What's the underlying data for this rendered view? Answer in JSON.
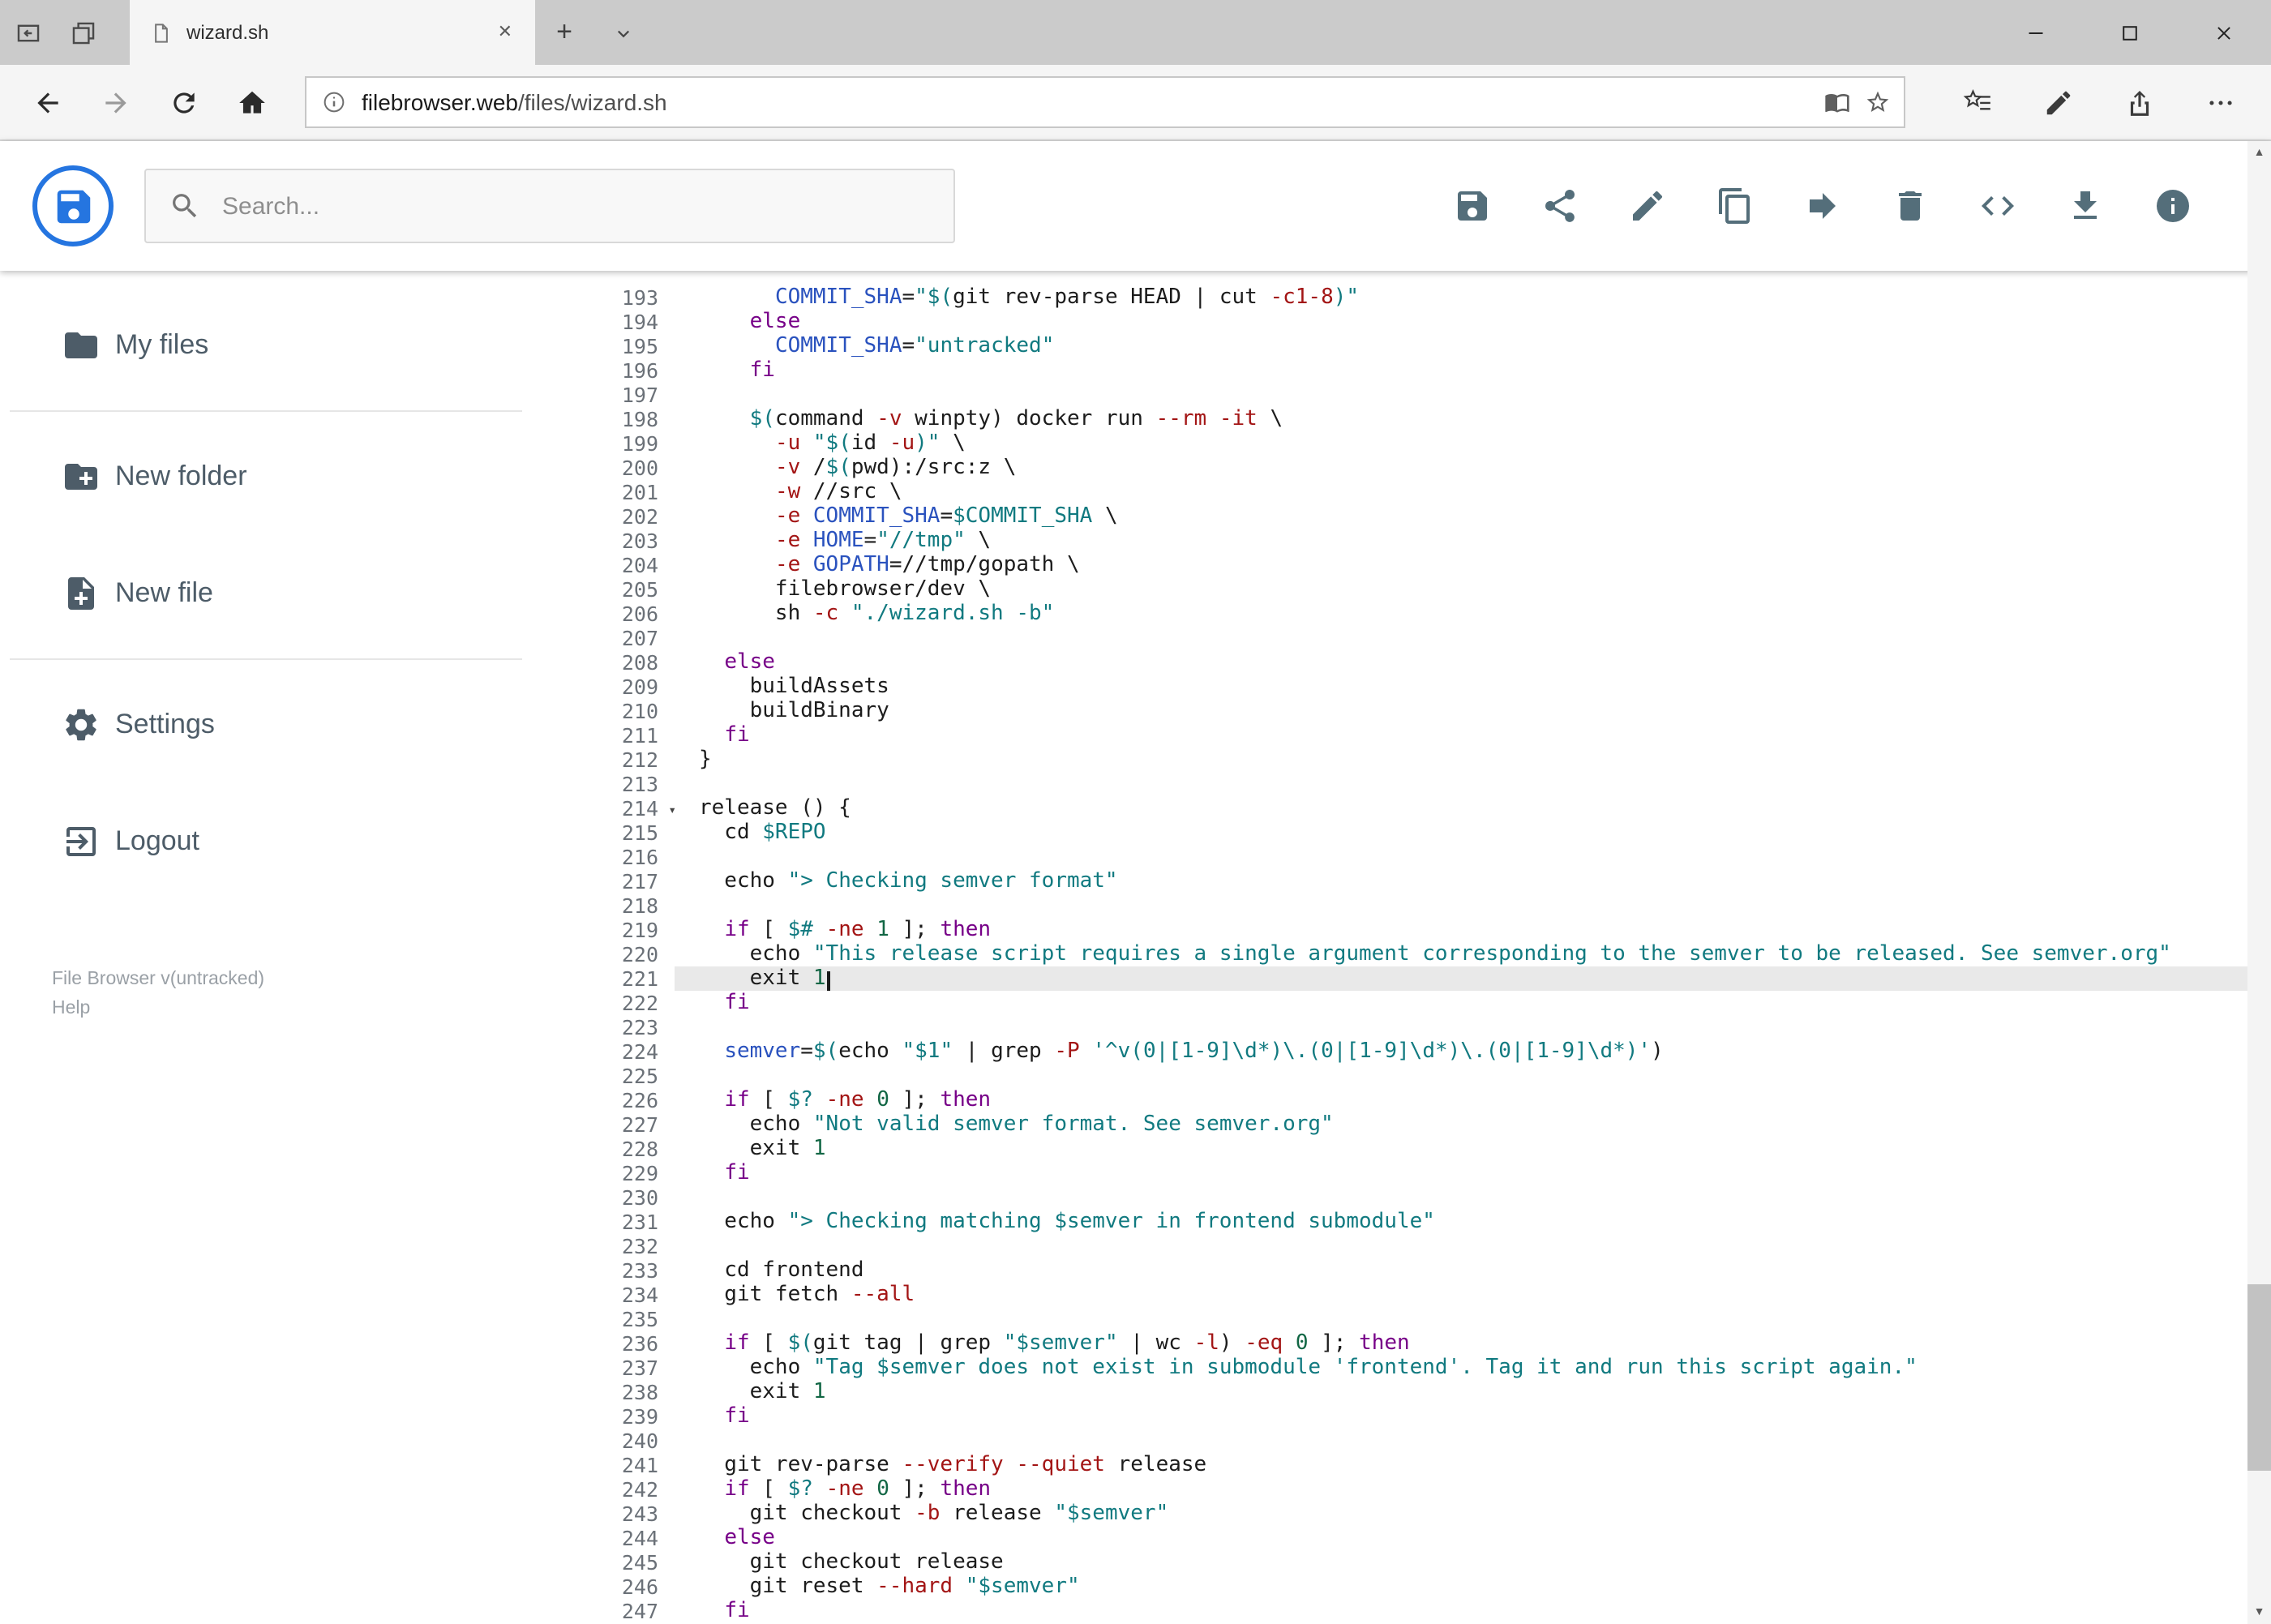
{
  "browser": {
    "tab": {
      "title": "wizard.sh"
    },
    "address": {
      "url_domain": "filebrowser.web",
      "url_path": "/files/wizard.sh"
    }
  },
  "app": {
    "header": {
      "search_placeholder": "Search...",
      "toolbar_buttons": [
        "save",
        "share",
        "rename",
        "copy",
        "move",
        "delete",
        "code",
        "download",
        "info"
      ]
    },
    "sidebar": {
      "items": [
        {
          "label": "My files",
          "icon": "folder"
        },
        {
          "label": "New folder",
          "icon": "create-new-folder"
        },
        {
          "label": "New file",
          "icon": "note-add"
        },
        {
          "label": "Settings",
          "icon": "settings"
        },
        {
          "label": "Logout",
          "icon": "logout"
        }
      ],
      "footer_version": "File Browser v(untracked)",
      "footer_help": "Help"
    },
    "editor": {
      "first_line_number": 193,
      "active_line_number": 221,
      "folded_line_number": 214,
      "lines": [
        "      COMMIT_SHA=\"$(git rev-parse HEAD | cut -c1-8)\"",
        "    else",
        "      COMMIT_SHA=\"untracked\"",
        "    fi",
        "",
        "    $(command -v winpty) docker run --rm -it \\",
        "      -u \"$(id -u)\" \\",
        "      -v /$(pwd):/src:z \\",
        "      -w //src \\",
        "      -e COMMIT_SHA=$COMMIT_SHA \\",
        "      -e HOME=\"//tmp\" \\",
        "      -e GOPATH=//tmp/gopath \\",
        "      filebrowser/dev \\",
        "      sh -c \"./wizard.sh -b\"",
        "",
        "  else",
        "    buildAssets",
        "    buildBinary",
        "  fi",
        "}",
        "",
        "release () {",
        "  cd $REPO",
        "",
        "  echo \"> Checking semver format\"",
        "",
        "  if [ $# -ne 1 ]; then",
        "    echo \"This release script requires a single argument corresponding to the semver to be released. See semver.org\"",
        "    exit 1",
        "  fi",
        "",
        "  semver=$(echo \"$1\" | grep -P '^v(0|[1-9]\\d*)\\.(0|[1-9]\\d*)\\.(0|[1-9]\\d*)')",
        "",
        "  if [ $? -ne 0 ]; then",
        "    echo \"Not valid semver format. See semver.org\"",
        "    exit 1",
        "  fi",
        "",
        "  echo \"> Checking matching $semver in frontend submodule\"",
        "",
        "  cd frontend",
        "  git fetch --all",
        "",
        "  if [ $(git tag | grep \"$semver\" | wc -l) -eq 0 ]; then",
        "    echo \"Tag $semver does not exist in submodule 'frontend'. Tag it and run this script again.\"",
        "    exit 1",
        "  fi",
        "",
        "  git rev-parse --verify --quiet release",
        "  if [ $? -ne 0 ]; then",
        "    git checkout -b release \"$semver\"",
        "  else",
        "    git checkout release",
        "    git reset --hard \"$semver\"",
        "  fi"
      ]
    }
  },
  "colors": {
    "accent_blue": "#2575e0",
    "syntax": {
      "keyword": "#770088",
      "string": "#117a80",
      "variable": "#117a80",
      "flag": "#a31515",
      "definition": "#2a52be",
      "number": "#116644"
    }
  }
}
